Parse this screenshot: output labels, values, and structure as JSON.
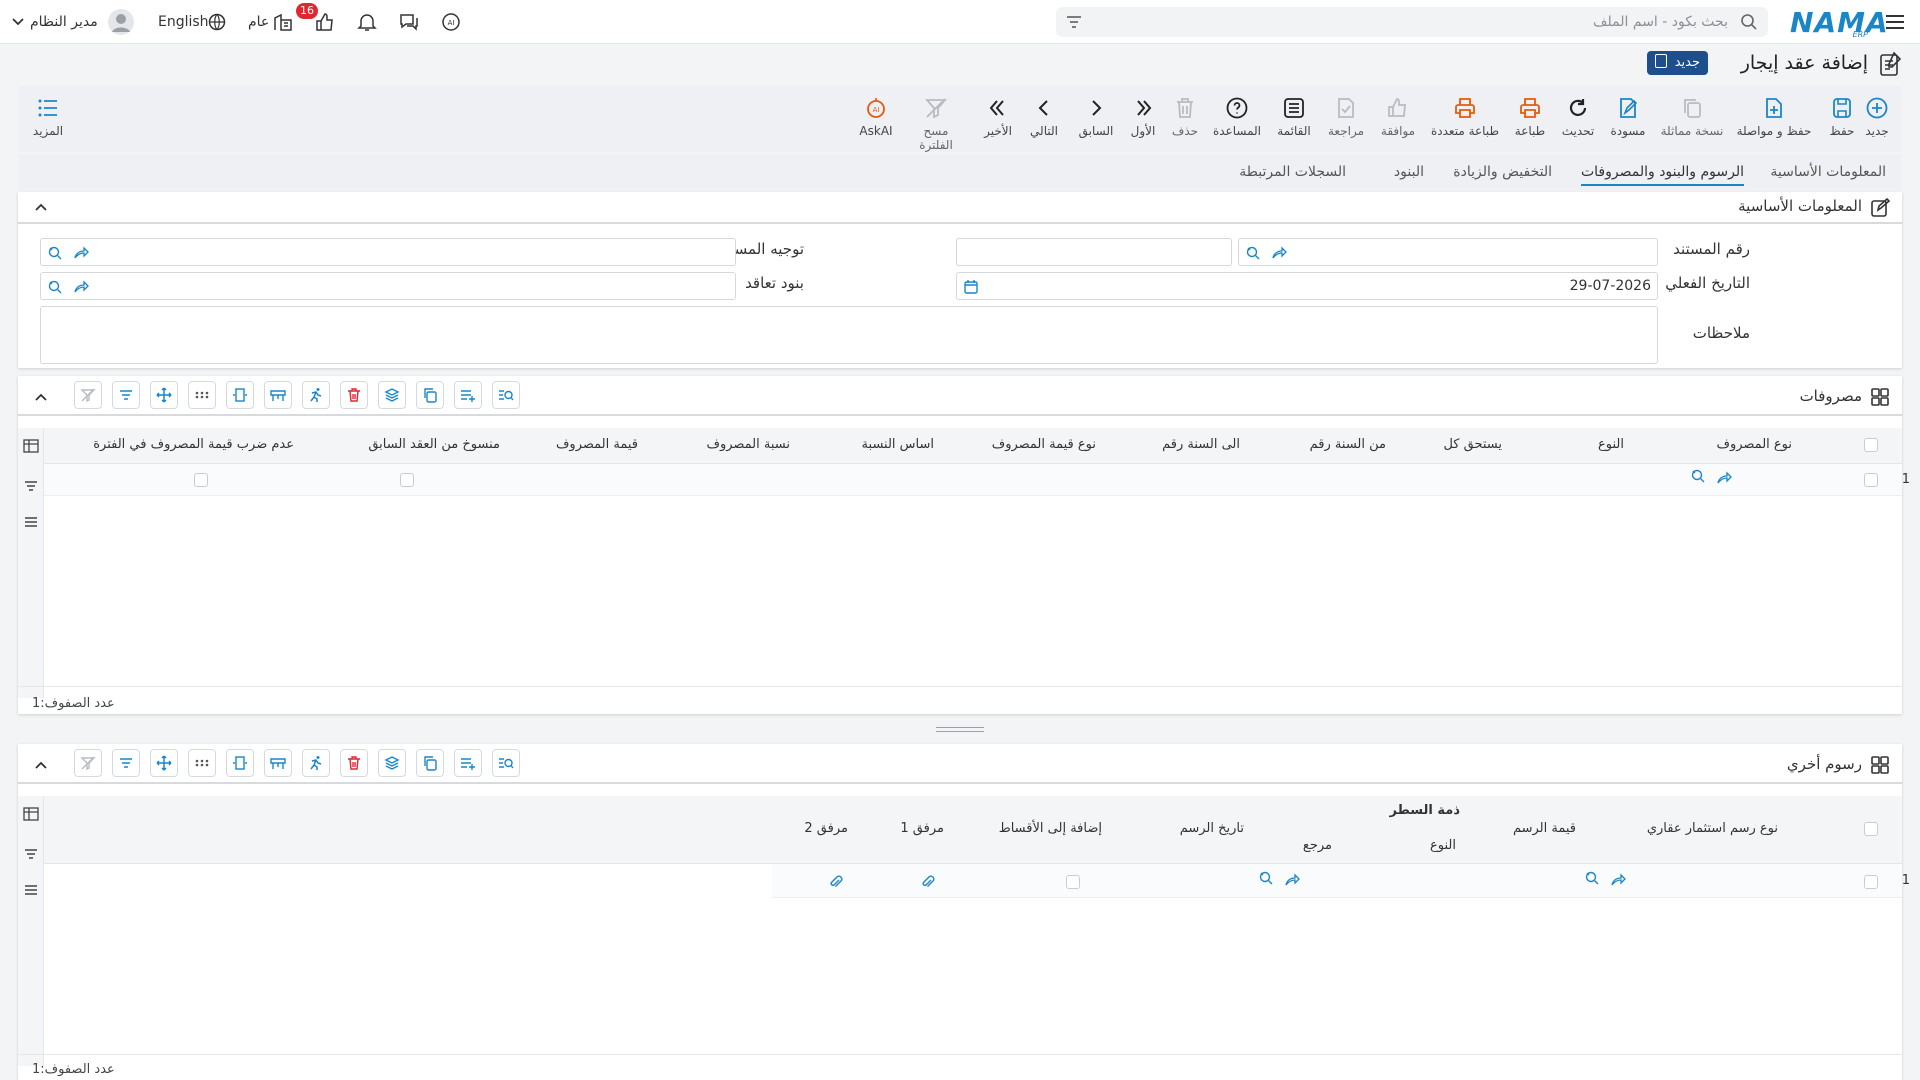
{
  "topbar": {
    "logo": "NAMA",
    "logo_sub": "ERP",
    "search_placeholder": "بحث بكود - اسم الملف",
    "notifications_count": "16",
    "general_label": "عام",
    "language_label": "English",
    "user_name": "مدير النظام"
  },
  "page": {
    "title": "إضافة عقد إيجار",
    "status_badge": "جديد"
  },
  "toolbar": {
    "items": [
      {
        "label": "جديد",
        "icon": "plus-circle-icon"
      },
      {
        "label": "حفظ",
        "icon": "save-icon"
      },
      {
        "label": "حفظ و مواصلة",
        "icon": "save-continue-icon"
      },
      {
        "label": "نسخة مماثلة",
        "icon": "copy-icon"
      },
      {
        "label": "مسودة",
        "icon": "draft-icon"
      },
      {
        "label": "تحديث",
        "icon": "refresh-icon"
      },
      {
        "label": "طباعة",
        "icon": "print-icon"
      },
      {
        "label": "طباعة متعددة",
        "icon": "multi-print-icon"
      },
      {
        "label": "موافقة",
        "icon": "thumbs-up-icon"
      },
      {
        "label": "مراجعة",
        "icon": "review-icon"
      },
      {
        "label": "القائمة",
        "icon": "list-icon"
      },
      {
        "label": "المساعدة",
        "icon": "help-icon"
      },
      {
        "label": "حذف",
        "icon": "trash-icon"
      },
      {
        "label": "الأول",
        "icon": "first-icon"
      },
      {
        "label": "السابق",
        "icon": "prev-icon"
      },
      {
        "label": "التالي",
        "icon": "next-icon"
      },
      {
        "label": "الأخير",
        "icon": "last-icon"
      },
      {
        "label": "مسح الفلترة",
        "icon": "clear-filter-icon"
      },
      {
        "label": "AskAI",
        "icon": "ai-icon"
      }
    ],
    "more_label": "المزيد"
  },
  "tabs": [
    "المعلومات الأساسية",
    "الرسوم والبنود والمصروفات",
    "التخفيض والزيادة",
    "البنود",
    "السجلات المرتبطة"
  ],
  "basic_info": {
    "title": "المعلومات الأساسية",
    "doc_number_label": "رقم المستند",
    "doc_direction_label": "توجيه المستند",
    "actual_date_label": "التاريخ الفعلي",
    "actual_date_value": "29-07-2026",
    "contract_terms_label": "بنود تعاقد",
    "notes_label": "ملاحظات"
  },
  "expenses": {
    "title": "مصروفات",
    "columns": [
      "نوع المصروف",
      "النوع",
      "يستحق كل",
      "من السنة رقم",
      "الى السنة رقم",
      "نوع قيمة المصروف",
      "اساس النسبة",
      "نسبة المصروف",
      "قيمة المصروف",
      "منسوخ من العقد السابق",
      "عدم ضرب قيمة المصروف في الفترة"
    ],
    "row_number": "1",
    "row_count_label": "عدد الصفوف:",
    "row_count": "1"
  },
  "other_fees": {
    "title": "رسوم أخري",
    "columns": [
      "نوع رسم استثمار عقاري",
      "قيمة الرسم",
      "ذمة السطر",
      "النوع",
      "مرجع",
      "تاريخ الرسم",
      "إضافة إلى الأقساط",
      "مرفق 1",
      "مرفق 2"
    ],
    "row_number": "1",
    "row_count_label": "عدد الصفوف:",
    "row_count": "1"
  },
  "colors": {
    "accent": "#1a86c8",
    "badge": "#1f4e8c",
    "danger": "#e0272d",
    "orange": "#e8590c"
  }
}
